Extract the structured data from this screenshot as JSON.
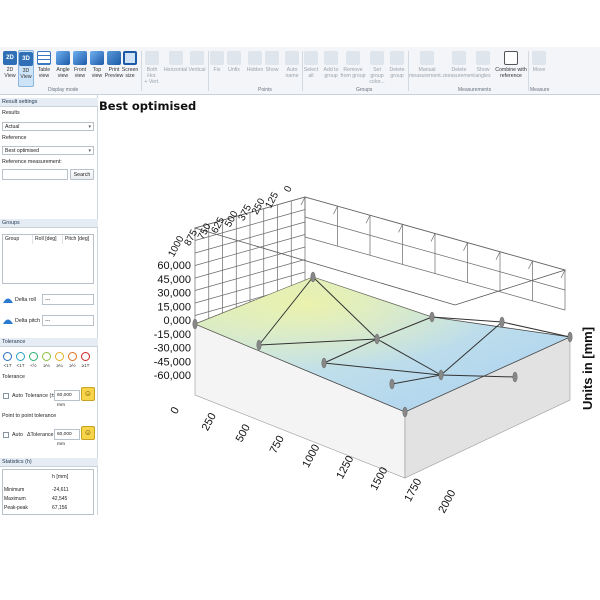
{
  "ribbon": {
    "buttons": [
      {
        "label": "2D\nView",
        "icon": "2d-view-icon"
      },
      {
        "label": "3D\nView",
        "icon": "3d-view-icon"
      },
      {
        "label": "Table\nview",
        "icon": "table-view-icon"
      },
      {
        "label": "Angle\nview",
        "icon": "angle-view-icon"
      },
      {
        "label": "Front\nview",
        "icon": "front-view-icon"
      },
      {
        "label": "Top\nview",
        "icon": "top-view-icon"
      },
      {
        "label": "Print\nPreview",
        "icon": "print-preview-icon"
      },
      {
        "label": "Screen\nsize",
        "icon": "screen-size-icon"
      },
      {
        "label": "Both Hor.\n+ Vert.",
        "icon": "both-icon"
      },
      {
        "label": "Horizontal",
        "icon": "horizontal-icon"
      },
      {
        "label": "Vertical",
        "icon": "vertical-icon"
      },
      {
        "label": "Fix",
        "icon": "fix-icon"
      },
      {
        "label": "Unfix",
        "icon": "unfix-icon"
      },
      {
        "label": "Hidden",
        "icon": "hidden-icon"
      },
      {
        "label": "Show",
        "icon": "show-icon"
      },
      {
        "label": "Auto\nname",
        "icon": "auto-name-icon"
      },
      {
        "label": "Select\nall",
        "icon": "select-all-icon"
      },
      {
        "label": "Add to\ngroup",
        "icon": "add-to-group-icon"
      },
      {
        "label": "Remove\nfrom group",
        "icon": "remove-from-group-icon"
      },
      {
        "label": "Set group\ncolor...",
        "icon": "set-group-color-icon"
      },
      {
        "label": "Delete\ngroup",
        "icon": "delete-group-icon"
      },
      {
        "label": "Manual\nmeasurement...",
        "icon": "manual-measurement-icon"
      },
      {
        "label": "Delete\nmeasurement",
        "icon": "delete-measurement-icon"
      },
      {
        "label": "Show\nangles",
        "icon": "show-angles-icon"
      },
      {
        "label": "Combine with\nreference",
        "icon": "combine-icon"
      },
      {
        "label": "Move",
        "icon": "move-icon"
      }
    ],
    "groups": [
      "Display mode",
      "Points",
      "Groups",
      "Measurements",
      "Measure"
    ]
  },
  "left": {
    "result_settings": {
      "header": "Result settings",
      "results_label": "Results",
      "results_value": "Actual",
      "reference_label": "Reference",
      "reference_value": "Best optimised",
      "reference_measurement_label": "Reference measurement:",
      "search_placeholder": "",
      "search_button": "Search"
    },
    "groups": {
      "header": "Groups",
      "columns": [
        "Group",
        "Roll [deg]",
        "Pitch [deg]"
      ],
      "delta_roll_label": "Delta roll",
      "delta_roll_value": "---",
      "delta_pitch_label": "Delta pitch",
      "delta_pitch_value": "---"
    },
    "tolerance": {
      "header": "Tolerance",
      "icons": [
        "<1T",
        "<1T",
        "<½",
        "≥⅛",
        "≥¼",
        "≥½",
        "≥1T"
      ],
      "sub_header": "Tolerance",
      "auto_label": "Auto",
      "tolerance_label": "Tolerance (±)",
      "tolerance_value": "60,000 mm",
      "p2p_header": "Point to point tolerance",
      "p2p_auto_label": "Auto",
      "p2p_label": "ΔTolerance",
      "p2p_value": "60,000 mm"
    },
    "statistics": {
      "header": "Statistics (h)",
      "column": "h [mm]",
      "rows": [
        {
          "label": "Minimum",
          "value": "-24,611"
        },
        {
          "label": "Maximum",
          "value": "42,545"
        },
        {
          "label": "Peak-peak",
          "value": "67,156"
        }
      ]
    }
  },
  "main": {
    "title": "Best optimised",
    "axis_unit_label": "Units in [mm]"
  },
  "chart_data": {
    "type": "surface",
    "title": "Best optimised",
    "zlabel": "Units in [mm]",
    "z_ticks": [
      "60,000",
      "45,000",
      "30,000",
      "15,000",
      "0,000",
      "-15,000",
      "-30,000",
      "-45,000",
      "-60,000"
    ],
    "x_ticks": [
      "0",
      "250",
      "500",
      "750",
      "1000",
      "1250",
      "1500",
      "1750",
      "2000"
    ],
    "y_ticks": [
      "1000",
      "875",
      "750",
      "625",
      "500",
      "375",
      "250",
      "125",
      "0"
    ],
    "zlim": [
      -60000,
      60000
    ],
    "colors": {
      "surface_low": "#a8d0f0",
      "surface_high": "#e4edb4",
      "grid": "#4a4a4a",
      "point": "#888888"
    }
  }
}
